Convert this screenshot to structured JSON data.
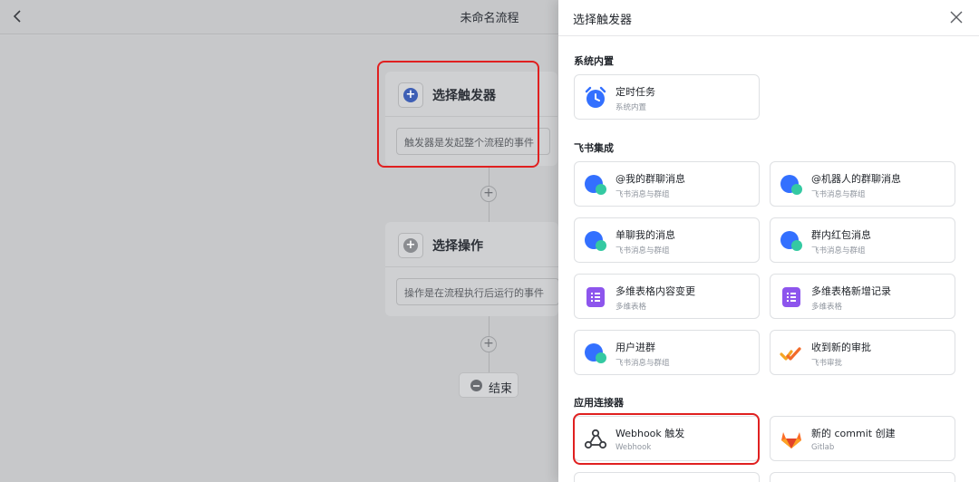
{
  "topbar": {
    "title": "未命名流程"
  },
  "canvas": {
    "trigger_node": {
      "title": "选择触发器",
      "placeholder": "触发器是发起整个流程的事件"
    },
    "action_node": {
      "title": "选择操作",
      "placeholder": "操作是在流程执行后运行的事件"
    },
    "end_label": "结束"
  },
  "panel": {
    "title": "选择触发器",
    "sections": [
      {
        "title": "系统内置"
      },
      {
        "title": "飞书集成"
      },
      {
        "title": "应用连接器"
      }
    ],
    "cards": [
      {
        "title": "定时任务",
        "subtitle": "系统内置",
        "icon": "alarm-clock-icon"
      },
      {
        "title": "@我的群聊消息",
        "subtitle": "飞书消息与群组",
        "icon": "chat-bubble-icon"
      },
      {
        "title": "@机器人的群聊消息",
        "subtitle": "飞书消息与群组",
        "icon": "chat-bubble-icon"
      },
      {
        "title": "单聊我的消息",
        "subtitle": "飞书消息与群组",
        "icon": "chat-bubble-icon"
      },
      {
        "title": "群内红包消息",
        "subtitle": "飞书消息与群组",
        "icon": "chat-bubble-icon"
      },
      {
        "title": "多维表格内容变更",
        "subtitle": "多维表格",
        "icon": "bitable-icon"
      },
      {
        "title": "多维表格新增记录",
        "subtitle": "多维表格",
        "icon": "bitable-icon"
      },
      {
        "title": "用户进群",
        "subtitle": "飞书消息与群组",
        "icon": "chat-bubble-icon"
      },
      {
        "title": "收到新的审批",
        "subtitle": "飞书审批",
        "icon": "approval-icon"
      },
      {
        "title": "Webhook 触发",
        "subtitle": "Webhook",
        "icon": "webhook-icon"
      },
      {
        "title": "新的 commit 创建",
        "subtitle": "Gitlab",
        "icon": "gitlab-icon"
      }
    ]
  },
  "colors": {
    "accent_blue": "#3370ff",
    "highlight_red": "#e02020",
    "bitable_purple": "#8d55ed",
    "chat_green": "#34c9a2"
  }
}
